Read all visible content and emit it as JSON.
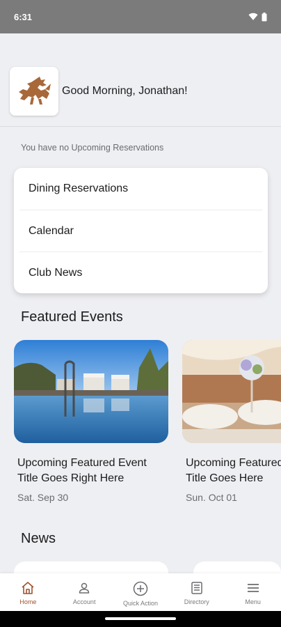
{
  "status_bar": {
    "time": "6:31"
  },
  "header": {
    "greeting": "Good Morning, Jonathan!"
  },
  "reservations": {
    "empty_text": "You have no Upcoming Reservations"
  },
  "quick_links": [
    {
      "label": "Dining Reservations"
    },
    {
      "label": "Calendar"
    },
    {
      "label": "Club News"
    }
  ],
  "featured_events": {
    "title": "Featured Events",
    "events": [
      {
        "title_line1": "Upcoming Featured Event",
        "title_line2": "Title Goes Right Here",
        "date": "Sat. Sep 30"
      },
      {
        "title_line1": "Upcoming Featured Event",
        "title_line2": "Title Goes Here",
        "date": "Sun. Oct 01"
      }
    ]
  },
  "news": {
    "title": "News"
  },
  "bottom_nav": [
    {
      "label": "Home",
      "icon": "home-icon",
      "active": true
    },
    {
      "label": "Account",
      "icon": "person-icon",
      "active": false
    },
    {
      "label": "Quick Action",
      "icon": "plus-circle-icon",
      "active": false
    },
    {
      "label": "Directory",
      "icon": "directory-icon",
      "active": false
    },
    {
      "label": "Menu",
      "icon": "menu-icon",
      "active": false
    }
  ],
  "colors": {
    "accent": "#a0522d",
    "logo": "#a8683a"
  }
}
